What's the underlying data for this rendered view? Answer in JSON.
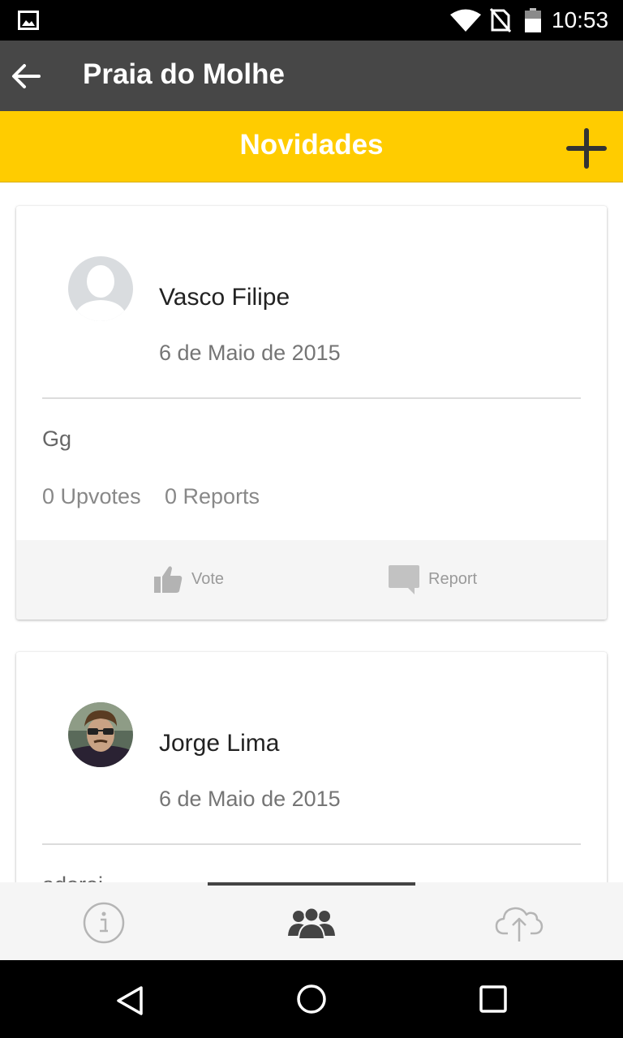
{
  "status_bar": {
    "time": "10:53",
    "icons": [
      "image-icon",
      "wifi-icon",
      "no-sim-icon",
      "battery-icon"
    ]
  },
  "app_bar": {
    "title": "Praia do Molhe",
    "back_icon": "arrow-left-icon"
  },
  "section": {
    "title": "Novidades",
    "add_icon": "plus-icon"
  },
  "posts": [
    {
      "author": "Vasco Filipe",
      "avatar": "default-user-silhouette",
      "date": "6 de Maio de 2015",
      "text": "Gg",
      "upvotes": "0 Upvotes",
      "reports": "0 Reports",
      "vote_label": "Vote",
      "report_label": "Report"
    },
    {
      "author": "Jorge Lima",
      "avatar": "user-photo",
      "date": "6 de Maio de 2015",
      "text": "adorei"
    }
  ],
  "bottom_nav": {
    "tabs": [
      {
        "icon": "info-icon",
        "selected": false
      },
      {
        "icon": "group-icon",
        "selected": true
      },
      {
        "icon": "cloud-upload-icon",
        "selected": false
      }
    ]
  },
  "system_nav": {
    "icons": [
      "nav-back-icon",
      "nav-home-icon",
      "nav-recents-icon"
    ]
  },
  "colors": {
    "status_bar": "#000000",
    "app_bar": "#474747",
    "accent": "#FFCC00",
    "card_actions_bg": "#F5F5F5",
    "muted_text": "#888888"
  }
}
